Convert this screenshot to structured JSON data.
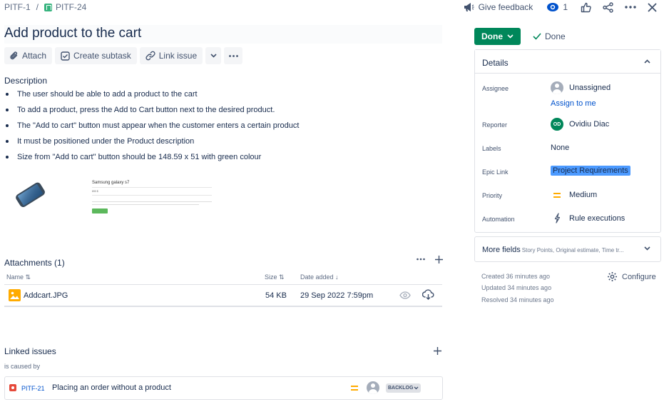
{
  "breadcrumb": {
    "parent": "PITF-1",
    "separator": "/",
    "current": "PITF-24"
  },
  "header": {
    "feedback_label": "Give feedback",
    "watch_count": "1"
  },
  "issue": {
    "title": "Add product to the cart"
  },
  "toolbar": {
    "attach": "Attach",
    "create_subtask": "Create subtask",
    "link_issue": "Link issue"
  },
  "description": {
    "label": "Description",
    "items": [
      "The user should be able to add a product to the cart",
      "To add a product, press the Add to Cart button next to the desired product.",
      "The \"Add to cart\" button must appear when the customer enters a certain product",
      "It must be positioned under the Product description",
      "Size from \"Add to cart\" button should be 148.59 x 51 with green colour"
    ],
    "image_title": "Samsung galaxy s7",
    "image_price": "890 $"
  },
  "attachments": {
    "label": "Attachments (1)",
    "columns": {
      "name": "Name",
      "size": "Size",
      "date": "Date added"
    },
    "files": [
      {
        "name": "Addcart.JPG",
        "size": "54 KB",
        "date": "29 Sep 2022 7:59pm"
      }
    ]
  },
  "linked_issues": {
    "label": "Linked issues",
    "relation": "is caused by",
    "items": [
      {
        "key": "PITF-21",
        "summary": "Placing an order without a product",
        "status": "BACKLOG"
      }
    ]
  },
  "status": {
    "button": "Done",
    "resolution": "Done"
  },
  "details": {
    "title": "Details",
    "assignee_label": "Assignee",
    "assignee": "Unassigned",
    "assign_to_me": "Assign to me",
    "reporter_label": "Reporter",
    "reporter": "Ovidiu Diac",
    "reporter_initials": "OD",
    "labels_label": "Labels",
    "labels": "None",
    "epic_label": "Epic Link",
    "epic": "Project Requirements",
    "priority_label": "Priority",
    "priority": "Medium",
    "automation_label": "Automation",
    "automation": "Rule executions"
  },
  "more_fields": {
    "label": "More fields",
    "hint": "Story Points, Original estimate, Time tr..."
  },
  "meta": {
    "created": "Created 36 minutes ago",
    "updated": "Updated 34 minutes ago",
    "resolved": "Resolved 34 minutes ago",
    "configure": "Configure"
  },
  "colors": {
    "done": "#00875A",
    "link": "#0052CC",
    "epic": "#4C9AFF",
    "priority": "#FFAB00",
    "bug": "#E5493A"
  }
}
